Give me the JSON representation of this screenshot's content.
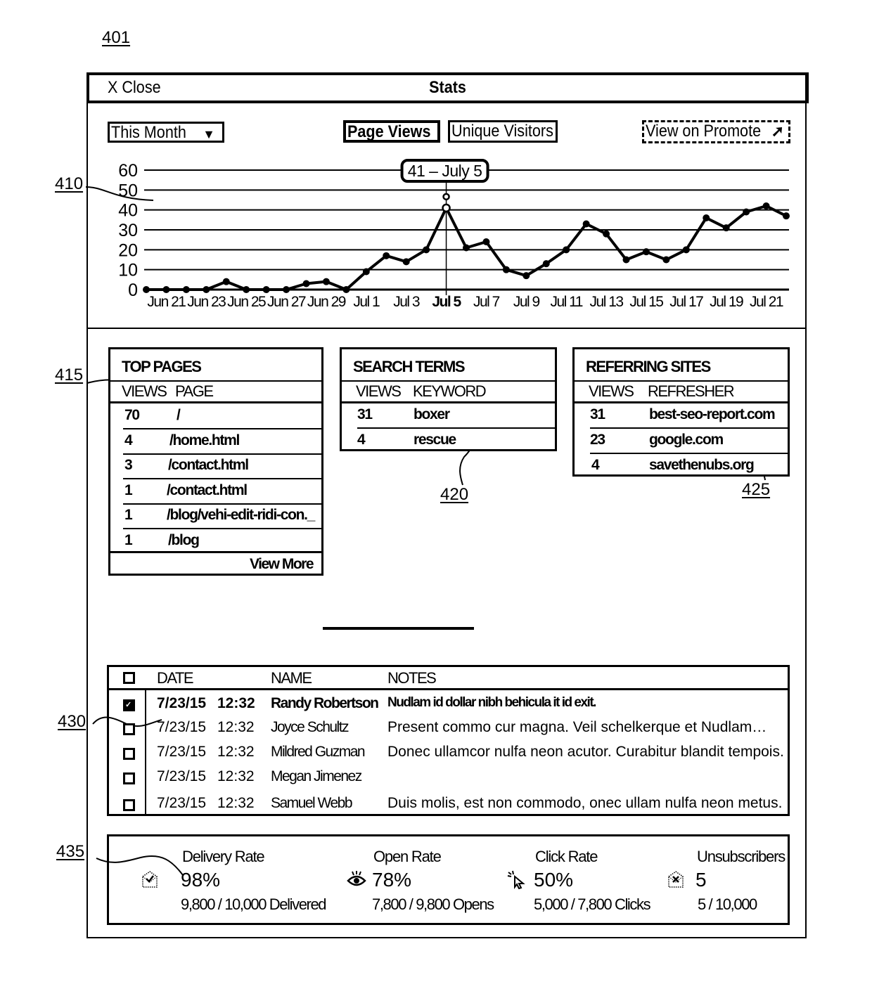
{
  "figure_refs": {
    "fig": "401",
    "chart": "410",
    "top_pages": "415",
    "search_terms": "420",
    "referring_sites": "425",
    "messages": "430",
    "email_stats": "435"
  },
  "window": {
    "close_label": "X Close",
    "title": "Stats"
  },
  "toolbar": {
    "range_select": {
      "selected": "This Month",
      "icon": "triangle-down-icon"
    },
    "tabs": [
      {
        "label": "Page Views",
        "active": true
      },
      {
        "label": "Unique Visitors",
        "active": false
      }
    ],
    "promote_link": {
      "label": "View on Promote",
      "icon": "external-arrow-icon"
    }
  },
  "chart_data": {
    "type": "line",
    "title": "",
    "xlabel": "",
    "ylabel": "",
    "ylim": [
      0,
      60
    ],
    "yticks": [
      "0",
      "10",
      "20",
      "30",
      "40",
      "50",
      "60"
    ],
    "grid": true,
    "x": [
      "Jun 20",
      "Jun 21",
      "Jun 22",
      "Jun 23",
      "Jun 24",
      "Jun 25",
      "Jun 26",
      "Jun 27",
      "Jun 28",
      "Jun 29",
      "Jun 30",
      "Jul 1",
      "Jul 2",
      "Jul 3",
      "Jul 4",
      "Jul 5",
      "Jul 6",
      "Jul 7",
      "Jul 8",
      "Jul 9",
      "Jul 10",
      "Jul 11",
      "Jul 12",
      "Jul 13",
      "Jul 14",
      "Jul 15",
      "Jul 16",
      "Jul 17",
      "Jul 18",
      "Jul 19",
      "Jul 20",
      "Jul 21",
      "Jul 22"
    ],
    "xtick_labels": [
      {
        "index": 1,
        "label": "Jun 21"
      },
      {
        "index": 3,
        "label": "Jun 23"
      },
      {
        "index": 5,
        "label": "Jun 25"
      },
      {
        "index": 7,
        "label": "Jun 27"
      },
      {
        "index": 9,
        "label": "Jun 29"
      },
      {
        "index": 11,
        "label": "Jul 1"
      },
      {
        "index": 13,
        "label": "Jul 3"
      },
      {
        "index": 15,
        "label": "Jul 5",
        "bold": true
      },
      {
        "index": 17,
        "label": "Jul 7"
      },
      {
        "index": 19,
        "label": "Jul 9"
      },
      {
        "index": 21,
        "label": "Jul 11"
      },
      {
        "index": 23,
        "label": "Jul 13"
      },
      {
        "index": 25,
        "label": "Jul 15"
      },
      {
        "index": 27,
        "label": "Jul 17"
      },
      {
        "index": 29,
        "label": "Jul 19"
      },
      {
        "index": 31,
        "label": "Jul 21"
      }
    ],
    "series": [
      {
        "name": "Page Views",
        "values": [
          0,
          0,
          0,
          0,
          4,
          0,
          0,
          0,
          3,
          4,
          0,
          9,
          17,
          14,
          20,
          41,
          21,
          24,
          10,
          7,
          13,
          20,
          33,
          28,
          15,
          19,
          15,
          20,
          36,
          31,
          39,
          42,
          37
        ]
      }
    ],
    "highlight": {
      "index": 15,
      "label": "41 – July 5"
    }
  },
  "top_pages": {
    "title": "TOP PAGES",
    "columns": [
      "VIEWS",
      "PAGE"
    ],
    "rows": [
      {
        "views": "70",
        "page": "/"
      },
      {
        "views": "4",
        "page": "/home.html"
      },
      {
        "views": "3",
        "page": "/contact.html"
      },
      {
        "views": "1",
        "page": "/contact.html"
      },
      {
        "views": "1",
        "page": "/blog/vehi-edit-ridi-con._"
      },
      {
        "views": "1",
        "page": "/blog"
      }
    ],
    "view_more": "View More"
  },
  "search_terms": {
    "title": "SEARCH TERMS",
    "columns": [
      "VIEWS",
      "KEYWORD"
    ],
    "rows": [
      {
        "views": "31",
        "keyword": "boxer"
      },
      {
        "views": "4",
        "keyword": "rescue"
      }
    ]
  },
  "referring_sites": {
    "title": "REFERRING SITES",
    "columns": [
      "VIEWS",
      "REFRESHER"
    ],
    "rows": [
      {
        "views": "31",
        "site": "best-seo-report.com"
      },
      {
        "views": "23",
        "site": "google.com"
      },
      {
        "views": "4",
        "site": "savethenubs.org"
      }
    ]
  },
  "messages": {
    "columns": [
      "DATE",
      "NAME",
      "NOTES"
    ],
    "rows": [
      {
        "checked": true,
        "unread": true,
        "date": "7/23/15",
        "time": "12:32",
        "name": "Randy Robertson",
        "notes": "Nudlam id dollar nibh behicula it id exit."
      },
      {
        "checked": false,
        "unread": false,
        "date": "7/23/15",
        "time": "12:32",
        "name": "Joyce Schultz",
        "notes": "Present commo cur magna.  Veil schelkerque et Nudlam…"
      },
      {
        "checked": false,
        "unread": false,
        "date": "7/23/15",
        "time": "12:32",
        "name": "Mildred Guzman",
        "notes": "Donec ullamcor nulfa neon acutor.  Curabitur blandit tempois."
      },
      {
        "checked": false,
        "unread": false,
        "date": "7/23/15",
        "time": "12:32",
        "name": "Megan Jimenez",
        "notes": ""
      },
      {
        "checked": false,
        "unread": false,
        "date": "7/23/15",
        "time": "12:32",
        "name": "Samuel Webb",
        "notes": "Duis molis, est non commodo, onec ullam nulfa neon metus."
      }
    ]
  },
  "email_stats": [
    {
      "label": "Delivery Rate",
      "value": "98%",
      "detail": "9,800 / 10,000 Delivered",
      "icon": "delivered-envelope-icon"
    },
    {
      "label": "Open Rate",
      "value": "78%",
      "detail": "7,800 / 9,800 Opens",
      "icon": "eye-icon"
    },
    {
      "label": "Click Rate",
      "value": "50%",
      "detail": "5,000 / 7,800 Clicks",
      "icon": "cursor-click-icon"
    },
    {
      "label": "Unsubscribers",
      "value": "5",
      "detail": "5 / 10,000",
      "icon": "unsubscribe-envelope-icon"
    }
  ]
}
